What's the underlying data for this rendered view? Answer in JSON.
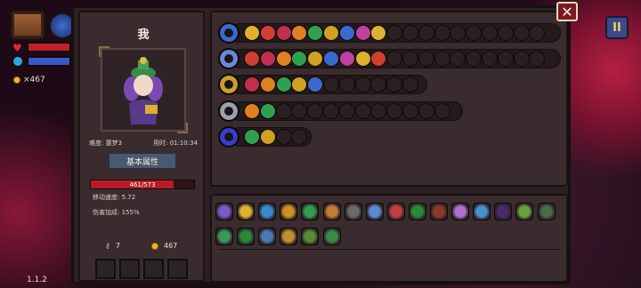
{
  "hud": {
    "coins": "×467",
    "version": "1.1.2",
    "hp_color": "#c0202e",
    "mana_color": "#3c57c8"
  },
  "dialog": {
    "character_name": "我",
    "difficulty_label": "难度: 噩梦3",
    "time_label": "用时: 01:10:34",
    "tab_label": "基本属性",
    "hp_text": "461/573",
    "hp_fraction": 0.805,
    "move_speed": "移动速度: 5.72",
    "damage_bonus": "伤害加成: 155%",
    "keys": "7",
    "coins": "467"
  },
  "weapons": [
    {
      "icon": "chest-weapon-icon",
      "color": "#3a6ad0"
    },
    {
      "icon": "magic-staff-icon",
      "color": "#6a8ad8"
    },
    {
      "icon": "golden-wand-icon",
      "color": "#c8a030"
    },
    {
      "icon": "spear-staff-icon",
      "color": "#9aa0b0"
    },
    {
      "icon": "dark-orb-icon",
      "color": "#3a3ad0"
    }
  ],
  "item_colors": [
    "#7a5ac8",
    "#e0b030",
    "#3a8ad0",
    "#d09020",
    "#30a050",
    "#c08030",
    "#6a6a6a",
    "#5a8ad0",
    "#c04040",
    "#2a8a3a",
    "#8a3a2a",
    "#b070d0",
    "#4a90d0",
    "#4a2a6a",
    "#6aa040",
    "#4a6a4a",
    "#3a9a5a",
    "#2a8a3a",
    "#4a7ab0",
    "#c09030",
    "#5a8a3a",
    "#3a8a4a"
  ]
}
